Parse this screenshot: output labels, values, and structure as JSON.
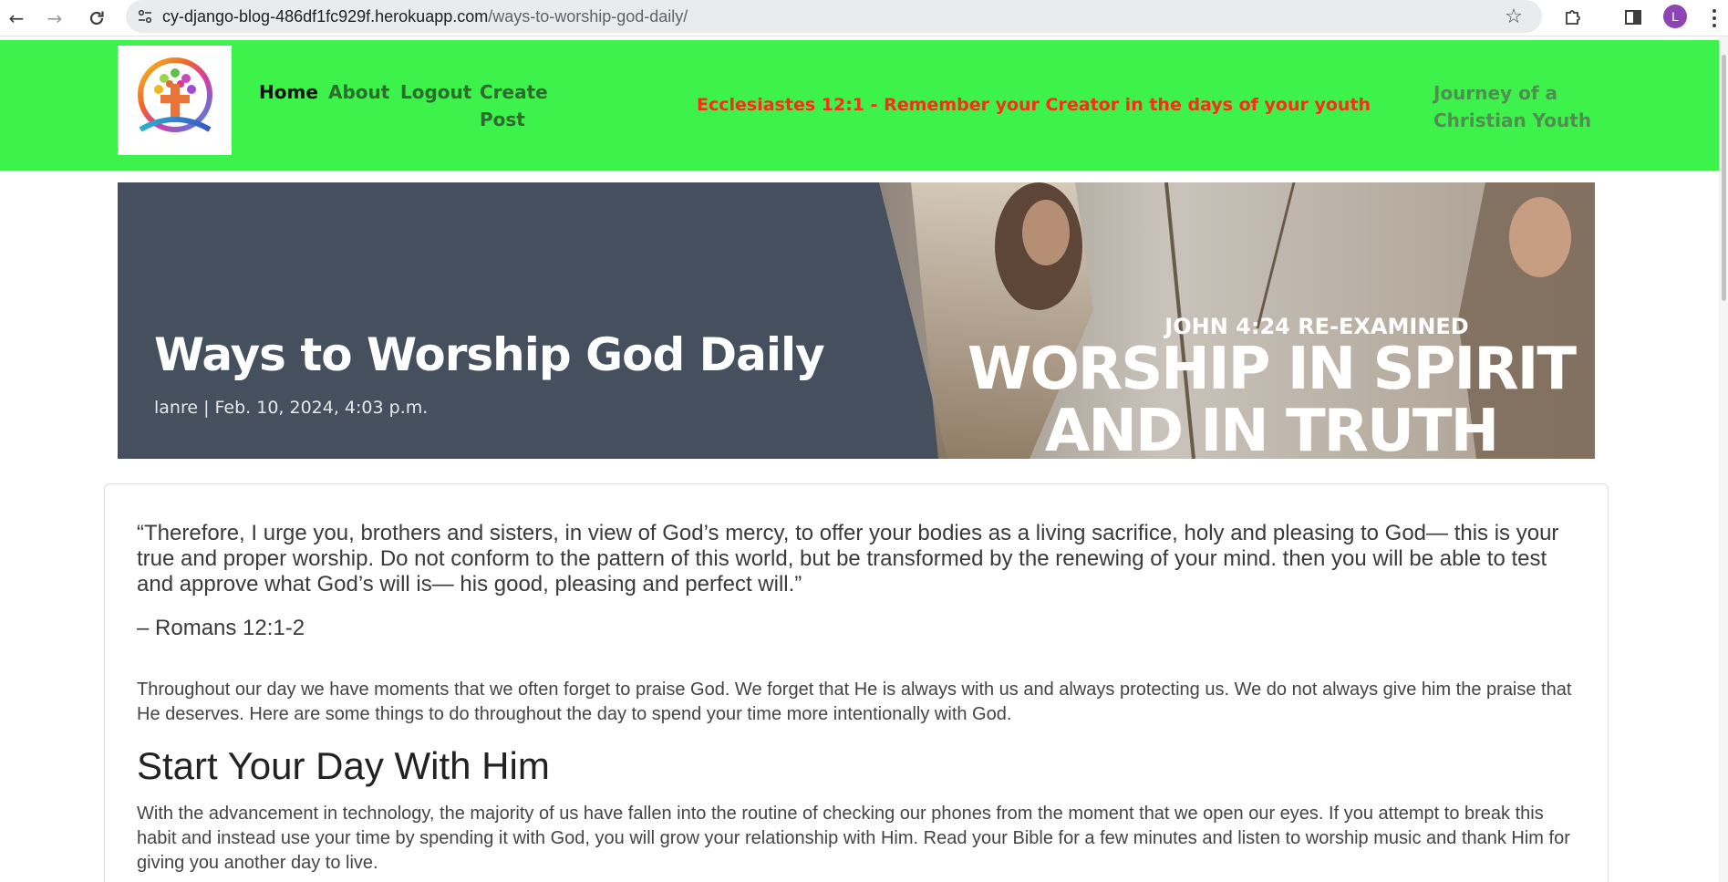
{
  "browser": {
    "url_host": "cy-django-blog-486df1fc929f.herokuapp.com",
    "url_path": "/ways-to-worship-god-daily/",
    "profile_initial": "L",
    "icons": {
      "back": "back-arrow-icon",
      "forward": "forward-arrow-icon",
      "reload": "reload-icon",
      "site_info": "site-info-icon",
      "bookmark": "star-icon",
      "extensions": "puzzle-icon",
      "side_panel": "side-panel-icon",
      "menu": "kebab-menu-icon"
    }
  },
  "navbar": {
    "background_color": "#3df24b",
    "links": [
      {
        "label": "Home",
        "active": true
      },
      {
        "label": "About",
        "active": false
      },
      {
        "label": "Logout",
        "active": false
      },
      {
        "label": "Create Post",
        "line1": "Create",
        "line2": "Post",
        "active": false
      }
    ],
    "verse": "Ecclesiastes 12:1 - Remember your Creator in the days of your youth",
    "verse_color": "#ff2a1a",
    "brand_line1": "Journey of a",
    "brand_line2": "Christian Youth"
  },
  "hero": {
    "title": "Ways to Worship God Daily",
    "meta": "lanre | Feb. 10, 2024, 4:03 p.m.",
    "image_kicker": "JOHN 4:24 RE-EXAMINED",
    "image_headline_1": "WORSHIP IN SPIRIT",
    "image_headline_2": "AND IN TRUTH",
    "panel_color": "#454f5d"
  },
  "post": {
    "quote": "“Therefore, I urge you, brothers and sisters, in view of God’s mercy, to offer your bodies as a living sacrifice, holy and pleasing to God— this is your true and proper worship. Do not conform to the pattern of this world, but be transformed by the renewing of your mind. then you will be able to test and approve what God’s will is— his good, pleasing and perfect will.”",
    "quote_source": "– Romans 12:1-2",
    "intro": "Throughout our day we have moments that we often forget to praise God. We forget that He is always with us and always protecting us. We do not always give him the praise that He deserves. Here are some things to do throughout the day to spend your time more intentionally with God.",
    "section_heading": "Start Your Day With Him",
    "section_body": "With the advancement in technology, the majority of us have fallen into the routine of checking our phones from the moment that we open our eyes. If you attempt to break this habit and instead use your time by spending it with God, you will grow your relationship with Him. Read your Bible for a few minutes and listen to worship music and thank Him for giving you another day to live."
  }
}
